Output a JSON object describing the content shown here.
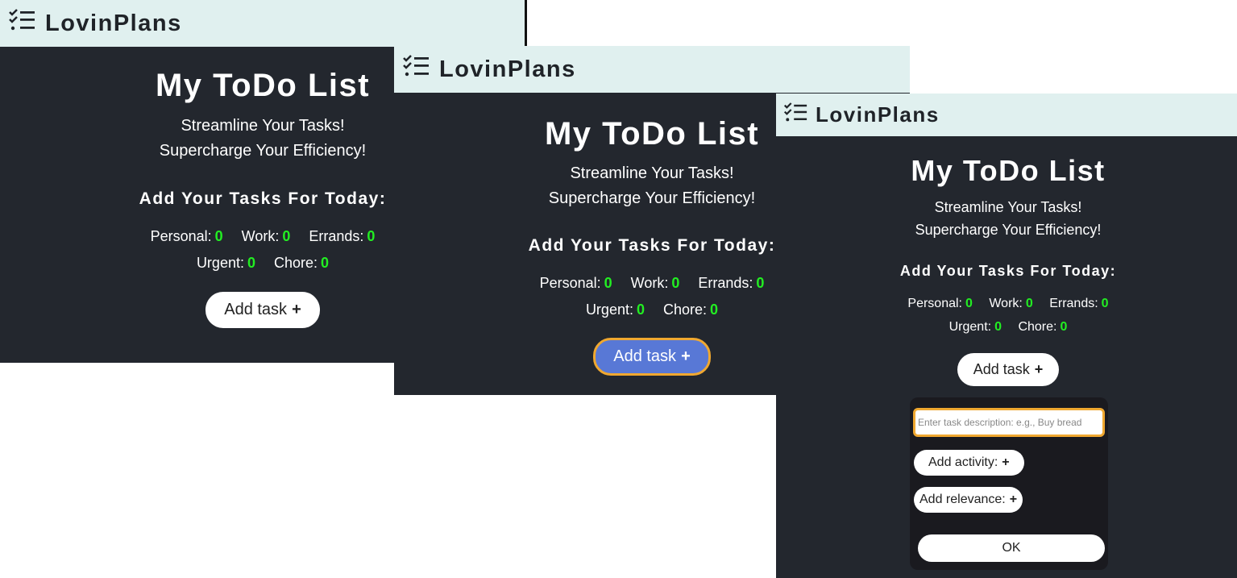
{
  "app": {
    "name": "LovinPlans",
    "logo_icon": "checklist-icon"
  },
  "main": {
    "title": "My ToDo List",
    "tagline_1": "Streamline Your Tasks!",
    "tagline_2": "Supercharge Your Efficiency!",
    "section_heading": "Add Your Tasks For Today:",
    "counts": [
      {
        "label": "Personal:",
        "value": "0"
      },
      {
        "label": "Work:",
        "value": "0"
      },
      {
        "label": "Errands:",
        "value": "0"
      },
      {
        "label": "Urgent:",
        "value": "0"
      },
      {
        "label": "Chore:",
        "value": "0"
      }
    ],
    "add_task_label": "Add task",
    "plus_glyph": "+"
  },
  "form": {
    "task_placeholder": "Enter task description: e.g., Buy bread",
    "add_activity_label": "Add activity:",
    "add_relevance_label": "Add relevance:",
    "ok_label": "OK"
  },
  "colors": {
    "header_bg": "#e0f0ef",
    "page_bg": "#23272e",
    "count_value": "#22ee22",
    "focus_ring": "#f0a830",
    "button_active": "#5878d6"
  }
}
